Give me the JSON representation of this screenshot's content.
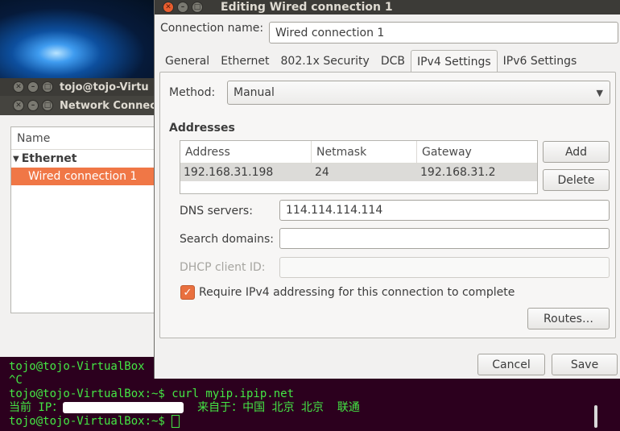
{
  "terminal_window": {
    "title": "tojo@tojo-Virtu"
  },
  "network_connections": {
    "title": "Network Connec",
    "list": {
      "header": "Name",
      "group": "Ethernet",
      "selected_item": "Wired connection 1"
    }
  },
  "dialog": {
    "title": "Editing Wired connection 1",
    "connection_name_label": "Connection name:",
    "connection_name_value": "Wired connection 1",
    "tabs": [
      "General",
      "Ethernet",
      "802.1x Security",
      "DCB",
      "IPv4 Settings",
      "IPv6 Settings"
    ],
    "active_tab": "IPv4 Settings",
    "method_label": "Method:",
    "method_value": "Manual",
    "addresses_heading": "Addresses",
    "addresses_columns": [
      "Address",
      "Netmask",
      "Gateway"
    ],
    "addresses_rows": [
      {
        "address": "192.168.31.198",
        "netmask": "24",
        "gateway": "192.168.31.2"
      }
    ],
    "add_button": "Add",
    "delete_button": "Delete",
    "dns_label": "DNS servers:",
    "dns_value": "114.114.114.114",
    "search_domains_label": "Search domains:",
    "search_domains_value": "",
    "dhcp_client_id_label": "DHCP client ID:",
    "dhcp_client_id_value": "",
    "require_ipv4_label": "Require IPv4 addressing for this connection to complete",
    "require_ipv4_checked": true,
    "routes_button": "Routes…",
    "cancel_button": "Cancel",
    "save_button": "Save"
  },
  "terminal": {
    "lines": [
      "tojo@tojo-VirtualBox",
      "^C",
      "tojo@tojo-VirtualBox:~$ curl myip.ipip.net",
      "当前 IP：",
      "  来自于：中国 北京 北京  联通",
      "tojo@tojo-VirtualBox:~$ "
    ]
  },
  "colors": {
    "accent": "#f07746",
    "terminal_bg": "#2c001e",
    "terminal_text": "#44e744",
    "titlebar": "#3c3b37"
  }
}
